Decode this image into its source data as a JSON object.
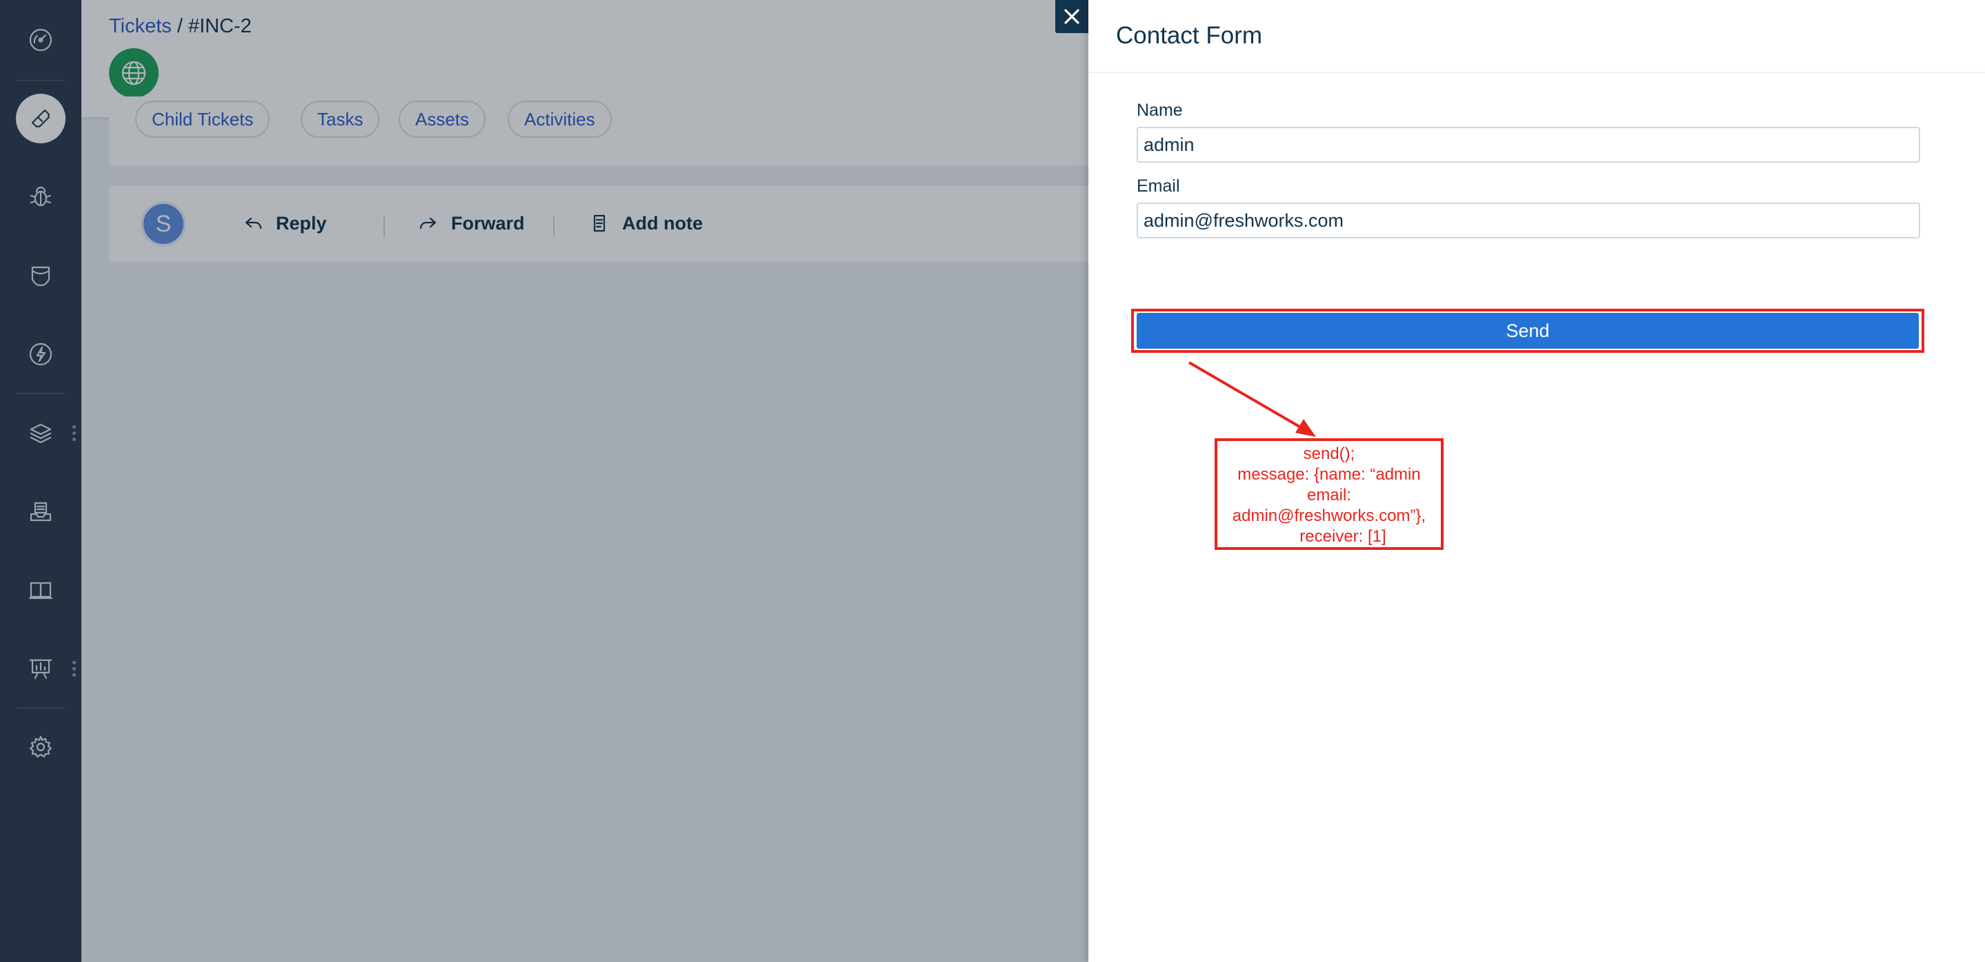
{
  "sidebar": {
    "items": [
      {
        "icon": "dashboard-icon"
      },
      {
        "icon": "ticket-icon",
        "active": true
      },
      {
        "icon": "bug-icon"
      },
      {
        "icon": "shield-icon"
      },
      {
        "icon": "bolt-icon"
      },
      {
        "icon": "layers-icon"
      },
      {
        "icon": "inbox-tray-icon"
      },
      {
        "icon": "book-icon"
      },
      {
        "icon": "presentation-icon"
      },
      {
        "icon": "gear-icon"
      }
    ]
  },
  "breadcrumb": {
    "link": "Tickets",
    "separator": " / ",
    "current": "#INC-2"
  },
  "tabs": [
    "Child Tickets",
    "Tasks",
    "Assets",
    "Activities"
  ],
  "reply_bar": {
    "avatar_initial": "S",
    "reply_label": "Reply",
    "forward_label": "Forward",
    "add_note_label": "Add note"
  },
  "drawer": {
    "title": "Contact Form",
    "name_label": "Name",
    "name_value": "admin",
    "email_label": "Email",
    "email_value": "admin@freshworks.com",
    "send_label": "Send"
  },
  "annotation": {
    "lines": [
      "send();",
      "message: {name: “admin",
      "email:",
      "admin@freshworks.com”},",
      "      receiver: [1]"
    ],
    "color": "#e8251d"
  },
  "colors": {
    "sidebar": "#2b3a4c",
    "primary": "#2473d6",
    "link": "#2c5cc5",
    "text": "#12344d",
    "avatar_bg": "#1fa25a"
  }
}
